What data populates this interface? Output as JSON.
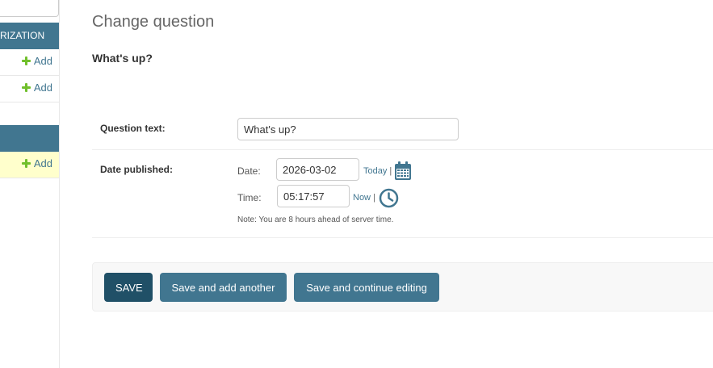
{
  "sidebar": {
    "modules": [
      {
        "caption": "RIZATION"
      },
      {
        "caption": ""
      }
    ],
    "add_label": "Add"
  },
  "page": {
    "title": "Change question",
    "object_title": "What's up?"
  },
  "form": {
    "question_text": {
      "label": "Question text:",
      "value": "What's up?"
    },
    "date_published": {
      "label": "Date published:",
      "date_label": "Date:",
      "date_value": "2026-03-02",
      "today_label": "Today",
      "time_label": "Time:",
      "time_value": "05:17:57",
      "now_label": "Now",
      "separator": "|",
      "help_note": "Note: You are 8 hours ahead of server time."
    }
  },
  "submit": {
    "save_label": "SAVE",
    "save_add_another_label": "Save and add another",
    "save_continue_label": "Save and continue editing"
  },
  "colors": {
    "primary": "#417690",
    "primary_dark": "#205067",
    "add_green": "#70bf2b",
    "highlight_row": "#ffffcc"
  },
  "icons": {
    "calendar": "calendar-icon",
    "clock": "clock-icon",
    "add": "plus-icon"
  }
}
